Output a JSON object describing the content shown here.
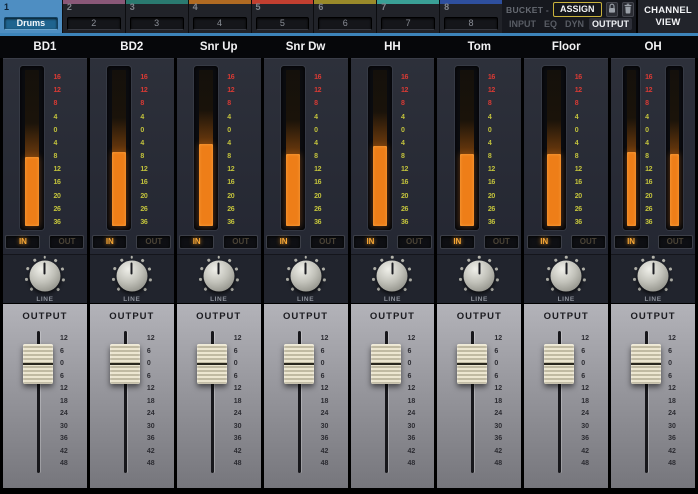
{
  "tab_bar": {
    "tabs": [
      {
        "number": "1",
        "field_text": "Drums",
        "selected": true,
        "stripe_color": "#4e8ec2"
      },
      {
        "number": "2",
        "field_text": "2",
        "selected": false,
        "stripe_color": "#8a5878"
      },
      {
        "number": "3",
        "field_text": "3",
        "selected": false,
        "stripe_color": "#2a7a70"
      },
      {
        "number": "4",
        "field_text": "4",
        "selected": false,
        "stripe_color": "#b06a22"
      },
      {
        "number": "5",
        "field_text": "5",
        "selected": false,
        "stripe_color": "#c23f30"
      },
      {
        "number": "6",
        "field_text": "6",
        "selected": false,
        "stripe_color": "#9a8a2a"
      },
      {
        "number": "7",
        "field_text": "7",
        "selected": false,
        "stripe_color": "#3aa096"
      },
      {
        "number": "8",
        "field_text": "8",
        "selected": false,
        "stripe_color": "#2e4f9e"
      }
    ],
    "bucket_label": "BUCKET -",
    "assign_button": "ASSIGN",
    "view_modes": [
      {
        "label": "INPUT",
        "active": false
      },
      {
        "label": "EQ",
        "active": false
      },
      {
        "label": "DYN",
        "active": false
      },
      {
        "label": "OUTPUT",
        "active": true
      }
    ],
    "channel_view_line1": "CHANNEL",
    "channel_view_line2": "VIEW"
  },
  "meter": {
    "scale": [
      "16",
      "12",
      "8",
      "4",
      "0",
      "4",
      "8",
      "12",
      "16",
      "20",
      "26",
      "36"
    ],
    "red_zone_labels": 3
  },
  "fader": {
    "scale": [
      "12",
      "6",
      "0",
      "6",
      "12",
      "18",
      "24",
      "30",
      "36",
      "42",
      "48"
    ]
  },
  "strip_labels": {
    "in": "IN",
    "out": "OUT",
    "knob": "LINE",
    "section": "OUTPUT"
  },
  "channels": [
    {
      "name": "BD1",
      "stereo": false,
      "meter_fill_pct": 42,
      "fader_db": 0
    },
    {
      "name": "BD2",
      "stereo": false,
      "meter_fill_pct": 45,
      "fader_db": 0
    },
    {
      "name": "Snr Up",
      "stereo": false,
      "meter_fill_pct": 50,
      "fader_db": 0
    },
    {
      "name": "Snr Dw",
      "stereo": false,
      "meter_fill_pct": 44,
      "fader_db": 0
    },
    {
      "name": "HH",
      "stereo": false,
      "meter_fill_pct": 49,
      "fader_db": 0
    },
    {
      "name": "Tom",
      "stereo": false,
      "meter_fill_pct": 44,
      "fader_db": 0
    },
    {
      "name": "Floor",
      "stereo": false,
      "meter_fill_pct": 44,
      "fader_db": 0
    },
    {
      "name": "OH",
      "stereo": true,
      "meter_fill_pct": 45,
      "meter_fill_pct_right": 44,
      "fader_db": 0
    }
  ],
  "colors": {
    "tab_selected_blue": "#4e8ec2",
    "underline_blue": "#3d84ba",
    "meter_orange": "#ee7e18",
    "assign_border_yellow": "#c9b23c",
    "meter_scale_red": "#d93a34",
    "meter_scale_yellow": "#c2c23c",
    "fader_section_gray": "#a9a9af"
  }
}
